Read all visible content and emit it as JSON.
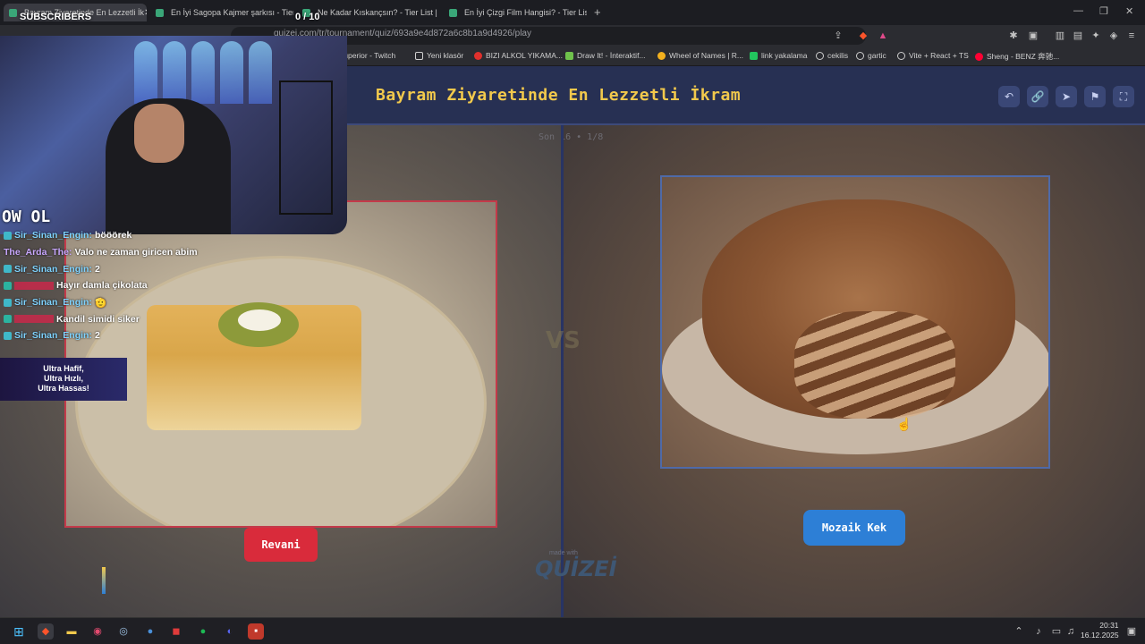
{
  "browser": {
    "tabs": [
      {
        "title": "Bayram Ziyaretinde En Lezzetli İk",
        "active": true
      },
      {
        "title": "En İyi Sagopa Kajmer şarkısı - Tier Li",
        "active": false
      },
      {
        "title": "Ne Kadar Kıskançsın? - Tier List | Kör",
        "active": false
      },
      {
        "title": "En İyi Çizgi Film Hangisi? - Tier List |",
        "active": false
      }
    ],
    "url": "quizei.com/tr/tournament/quiz/693a9e4d872a6c8b1a9d4926/play",
    "bookmarks": [
      {
        "label": "superior - Twitch",
        "color": "#9146ff"
      },
      {
        "label": "Yeni klasör",
        "color": "#d0d0d0"
      },
      {
        "label": "BIZI ALKOL YIKAMA...",
        "color": "#e0302c"
      },
      {
        "label": "Draw It! - İnteraktif...",
        "color": "#6fc24b"
      },
      {
        "label": "Wheel of Names | R...",
        "color": "#f2b01e"
      },
      {
        "label": "link yakalama",
        "color": "#22c55e"
      },
      {
        "label": "cekilis",
        "color": "#cccccc"
      },
      {
        "label": "gartic",
        "color": "#cccccc"
      },
      {
        "label": "Vite + React + TS",
        "color": "#a78bfa"
      },
      {
        "label": "Sheng - BENZ 奔驰...",
        "color": "#ff0033"
      }
    ]
  },
  "quiz": {
    "title": "Bayram Ziyaretinde En Lezzetli İkram",
    "progress": "Son 16 • 1/8",
    "left_option": "Revani",
    "right_option": "Mozaik Kek",
    "vs": "VS",
    "footer_small": "made with",
    "footer_logo": "QUİZEİ",
    "colors": {
      "title": "#f2c94c",
      "left_accent": "#d92b3b",
      "right_accent": "#2d7fd6",
      "header_bg": "#273053"
    }
  },
  "stream": {
    "subs_label": "SUBSCRIBERS",
    "subs_count": "0 / 10",
    "brand": "OW OL",
    "chat": [
      {
        "user": "Sir_Sinan_Engin:",
        "text": "bööörek",
        "user_color": "#7fd3ff"
      },
      {
        "user": "The_Arda_The:",
        "text": "Valo ne zaman giricen abim",
        "user_color": "#c9a8ff"
      },
      {
        "user": "Sir_Sinan_Engin:",
        "text": "2",
        "user_color": "#7fd3ff"
      },
      {
        "user": "",
        "text": "Hayır damla çikolata",
        "user_color": "#ff4d6d"
      },
      {
        "user": "Sir_Sinan_Engin:",
        "text": "🫡",
        "user_color": "#7fd3ff"
      },
      {
        "user": "",
        "text": "Kandil simidi siker",
        "user_color": "#ff4d6d"
      },
      {
        "user": "Sir_Sinan_Engin:",
        "text": "2",
        "user_color": "#7fd3ff"
      }
    ],
    "ad_lines": [
      "Ultra Hafif,",
      "Ultra Hızlı,",
      "Ultra Hassas!"
    ]
  },
  "taskbar": {
    "time": "20:31",
    "date": "16.12.2025"
  }
}
